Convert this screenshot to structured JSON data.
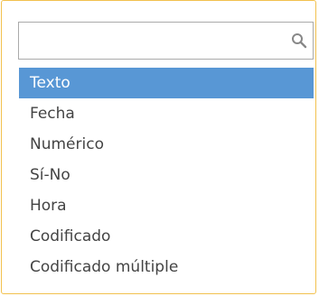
{
  "search": {
    "value": "",
    "placeholder": "",
    "icon": "search-icon"
  },
  "options": [
    {
      "label": "Texto",
      "selected": true
    },
    {
      "label": "Fecha",
      "selected": false
    },
    {
      "label": "Numérico",
      "selected": false
    },
    {
      "label": "Sí-No",
      "selected": false
    },
    {
      "label": "Hora",
      "selected": false
    },
    {
      "label": "Codificado",
      "selected": false
    },
    {
      "label": "Codificado múltiple",
      "selected": false
    }
  ],
  "colors": {
    "highlight": "#5897d5",
    "dropdown_border": "#f2c14e",
    "text": "#444444"
  }
}
